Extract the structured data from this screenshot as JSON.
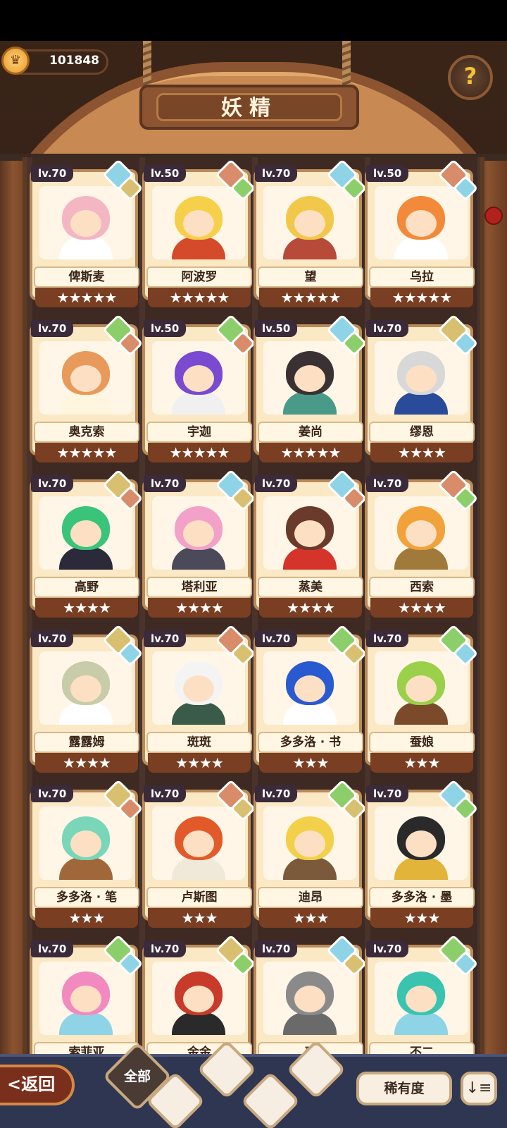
{
  "currency": {
    "value": "101848"
  },
  "header": {
    "title": "妖精",
    "help_label": "?"
  },
  "cards": [
    {
      "level": "lv.70",
      "name": "俾斯麦",
      "stars": "★★★★★",
      "hair": "#f4b6c2",
      "body": "#ffffff",
      "gem1": "#8ed4e6",
      "gem2": "#d9c070"
    },
    {
      "level": "lv.50",
      "name": "阿波罗",
      "stars": "★★★★★",
      "hair": "#f6d04a",
      "body": "#d44a2a",
      "gem1": "#d98c6a",
      "gem2": "#8ccf6a"
    },
    {
      "level": "lv.70",
      "name": "望",
      "stars": "★★★★★",
      "hair": "#f2c84a",
      "body": "#b84a3a",
      "gem1": "#8ed4e6",
      "gem2": "#8ccf6a"
    },
    {
      "level": "lv.50",
      "name": "乌拉",
      "stars": "★★★★★",
      "hair": "#f28a3a",
      "body": "#ffffff",
      "gem1": "#d98c6a",
      "gem2": "#8ed4e6"
    },
    {
      "level": "lv.70",
      "name": "奥克索",
      "stars": "★★★★★",
      "hair": "#e89a5a",
      "body": "#fff6e0",
      "gem1": "#8ccf6a",
      "gem2": "#d98c6a"
    },
    {
      "level": "lv.50",
      "name": "宇迦",
      "stars": "★★★★★",
      "hair": "#7a4ad0",
      "body": "#f0f0f0",
      "gem1": "#8ccf6a",
      "gem2": "#d98c6a"
    },
    {
      "level": "lv.50",
      "name": "姜尚",
      "stars": "★★★★★",
      "hair": "#3a3232",
      "body": "#4a9a8a",
      "gem1": "#8ed4e6",
      "gem2": "#8ccf6a"
    },
    {
      "level": "lv.70",
      "name": "缪恩",
      "stars": "★★★★",
      "hair": "#d8d8d8",
      "body": "#2a4a9a",
      "gem1": "#d9c070",
      "gem2": "#8ed4e6"
    },
    {
      "level": "lv.70",
      "name": "高野",
      "stars": "★★★★",
      "hair": "#3ac47a",
      "body": "#2a2a3a",
      "gem1": "#d9c070",
      "gem2": "#d98c6a"
    },
    {
      "level": "lv.70",
      "name": "塔利亚",
      "stars": "★★★★",
      "hair": "#f2a2c8",
      "body": "#4a4a5a",
      "gem1": "#8ed4e6",
      "gem2": "#d9c070"
    },
    {
      "level": "lv.70",
      "name": "蒸美",
      "stars": "★★★★",
      "hair": "#6a3a2a",
      "body": "#d4342a",
      "gem1": "#8ed4e6",
      "gem2": "#d98c6a"
    },
    {
      "level": "lv.70",
      "name": "西索",
      "stars": "★★★★",
      "hair": "#f2a23a",
      "body": "#a07a3a",
      "gem1": "#d98c6a",
      "gem2": "#8ccf6a"
    },
    {
      "level": "lv.70",
      "name": "露露姆",
      "stars": "★★★★",
      "hair": "#c8cca8",
      "body": "#ffffff",
      "gem1": "#d9c070",
      "gem2": "#8ed4e6"
    },
    {
      "level": "lv.70",
      "name": "斑斑",
      "stars": "★★★★",
      "hair": "#f4f4f4",
      "body": "#3a5a4a",
      "gem1": "#d98c6a",
      "gem2": "#d9c070"
    },
    {
      "level": "lv.70",
      "name": "多多洛 · 书",
      "stars": "★★★",
      "hair": "#2a5ad0",
      "body": "#ffffff",
      "gem1": "#8ccf6a",
      "gem2": "#d9c070"
    },
    {
      "level": "lv.70",
      "name": "蚕娘",
      "stars": "★★★",
      "hair": "#9ad04a",
      "body": "#7a4a2a",
      "gem1": "#8ccf6a",
      "gem2": "#8ed4e6"
    },
    {
      "level": "lv.70",
      "name": "多多洛 · 笔",
      "stars": "★★★",
      "hair": "#7ad6b8",
      "body": "#a0683a",
      "gem1": "#d9c070",
      "gem2": "#d98c6a"
    },
    {
      "level": "lv.70",
      "name": "卢斯图",
      "stars": "★★★",
      "hair": "#e25a2a",
      "body": "#f0e8d8",
      "gem1": "#d98c6a",
      "gem2": "#d9c070"
    },
    {
      "level": "lv.70",
      "name": "迪昂",
      "stars": "★★★",
      "hair": "#f2d04a",
      "body": "#7a5a3a",
      "gem1": "#8ccf6a",
      "gem2": "#d9c070"
    },
    {
      "level": "lv.70",
      "name": "多多洛 · 墨",
      "stars": "★★★",
      "hair": "#2a2a2a",
      "body": "#e2b43a",
      "gem1": "#8ed4e6",
      "gem2": "#8ccf6a"
    },
    {
      "level": "lv.70",
      "name": "索菲亚",
      "stars": "",
      "hair": "#f28ac0",
      "body": "#8ed4e6",
      "gem1": "#8ccf6a",
      "gem2": "#8ed4e6"
    },
    {
      "level": "lv.70",
      "name": "金金",
      "stars": "",
      "hair": "#c83a2a",
      "body": "#2a2a2a",
      "gem1": "#d9c070",
      "gem2": "#8ccf6a"
    },
    {
      "level": "lv.70",
      "name": "壶",
      "stars": "",
      "hair": "#8a8a8a",
      "body": "#6a6a6a",
      "gem1": "#8ed4e6",
      "gem2": "#d9c070"
    },
    {
      "level": "lv.70",
      "name": "不二",
      "stars": "",
      "hair": "#3ac4b0",
      "body": "#8ed4e6",
      "gem1": "#8ccf6a",
      "gem2": "#8ed4e6"
    }
  ],
  "bottom": {
    "back_label": "<返回",
    "filter_all_label": "全部",
    "sort_label": "稀有度",
    "order_icon": "↓≡"
  },
  "icons": {
    "coin": "coin-icon",
    "help": "question-icon",
    "filter_water": "water-drop-icon",
    "filter_leaf": "leaf-icon",
    "filter_mountain": "mountain-icon",
    "filter_fire": "volcano-icon"
  }
}
